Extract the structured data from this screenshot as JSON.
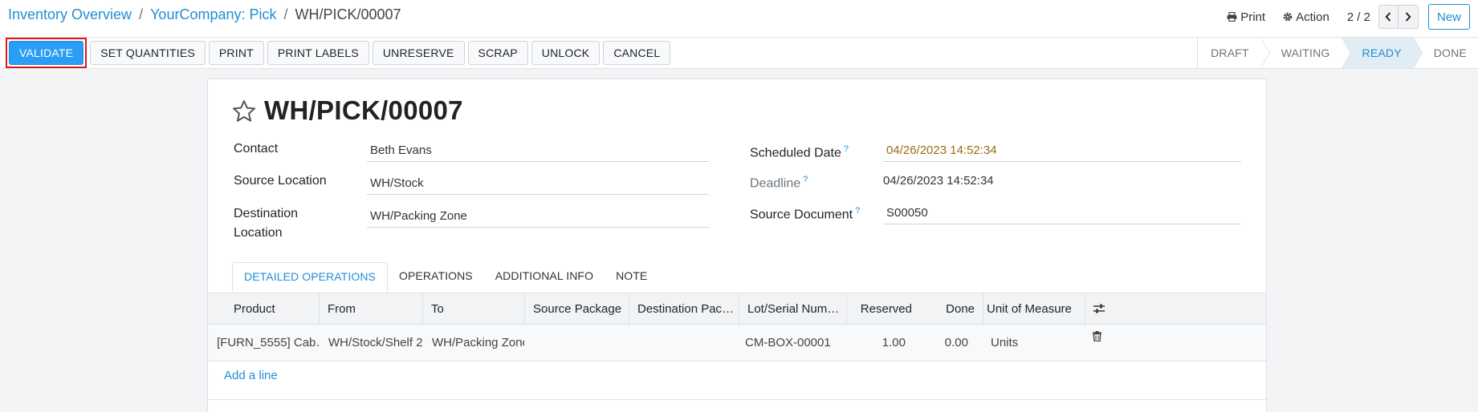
{
  "breadcrumb": {
    "items": [
      "Inventory Overview",
      "YourCompany: Pick"
    ],
    "current": "WH/PICK/00007",
    "separator": "/"
  },
  "top_actions": {
    "print_label": "Print",
    "action_label": "Action",
    "pager_value": "2 / 2",
    "new_label": "New"
  },
  "buttons": {
    "validate": "VALIDATE",
    "set_quantities": "SET QUANTITIES",
    "print": "PRINT",
    "print_labels": "PRINT LABELS",
    "unreserve": "UNRESERVE",
    "scrap": "SCRAP",
    "unlock": "UNLOCK",
    "cancel": "CANCEL"
  },
  "status": {
    "stages": [
      "DRAFT",
      "WAITING",
      "READY",
      "DONE"
    ],
    "active": "READY"
  },
  "record": {
    "title": "WH/PICK/00007",
    "fields": {
      "contact_label": "Contact",
      "contact_value": "Beth Evans",
      "source_location_label": "Source Location",
      "source_location_value": "WH/Stock",
      "destination_location_label": "Destination Location",
      "destination_location_value": "WH/Packing Zone",
      "scheduled_date_label": "Scheduled Date",
      "scheduled_date_value": "04/26/2023 14:52:34",
      "deadline_label": "Deadline",
      "deadline_value": "04/26/2023 14:52:34",
      "source_document_label": "Source Document",
      "source_document_value": "S00050",
      "help_mark": "?"
    }
  },
  "tabs": [
    "DETAILED OPERATIONS",
    "OPERATIONS",
    "ADDITIONAL INFO",
    "NOTE"
  ],
  "table": {
    "headers": {
      "product": "Product",
      "from": "From",
      "to": "To",
      "source_package": "Source Package",
      "destination_package": "Destination Pac…",
      "lot": "Lot/Serial Num…",
      "reserved": "Reserved",
      "done": "Done",
      "uom": "Unit of Measure"
    },
    "rows": [
      {
        "product": "[FURN_5555] Cab…",
        "from": "WH/Stock/Shelf 2",
        "to": "WH/Packing Zone",
        "source_package": "",
        "destination_package": "",
        "lot": "CM-BOX-00001",
        "reserved": "1.00",
        "done": "0.00",
        "uom": "Units"
      }
    ],
    "add_line": "Add a line"
  },
  "colors": {
    "accent": "#1f8ed6",
    "primary_button": "#2a9df4",
    "highlight_border": "#e0141e",
    "warning_text": "#9c6d11"
  }
}
